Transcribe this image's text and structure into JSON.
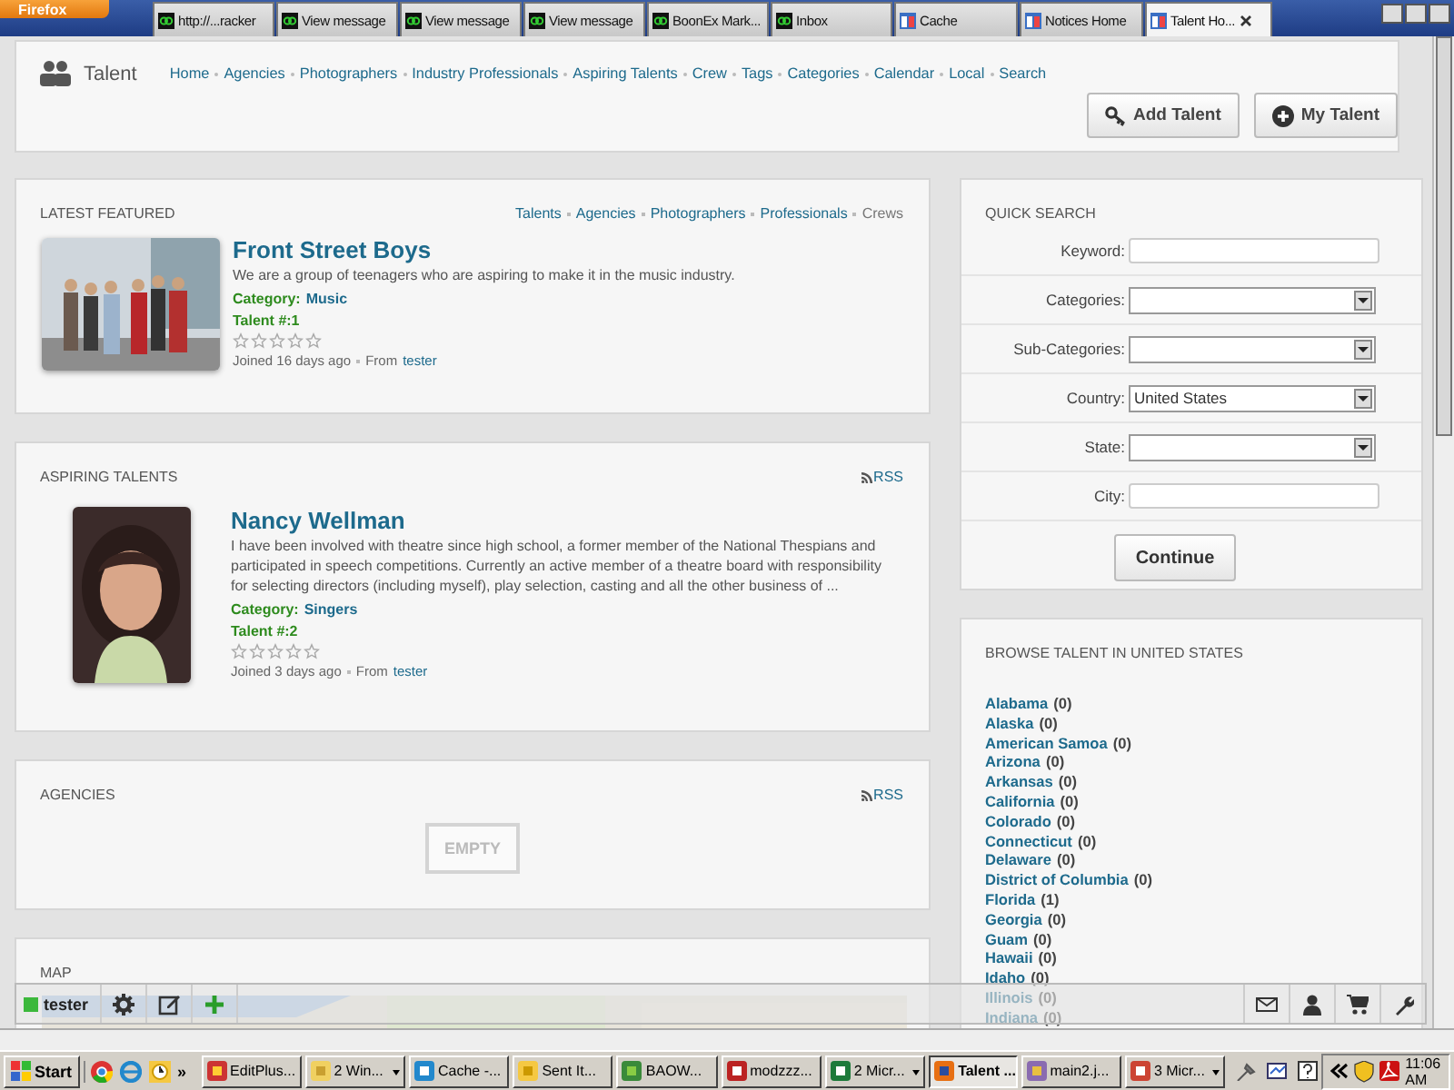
{
  "browser": {
    "menu_button": "Firefox",
    "tabs": [
      {
        "label": "http://...racker",
        "kind": "site",
        "selected": false
      },
      {
        "label": "View message",
        "kind": "site",
        "selected": false
      },
      {
        "label": "View message",
        "kind": "site",
        "selected": false
      },
      {
        "label": "View message",
        "kind": "site",
        "selected": false
      },
      {
        "label": "BoonEx Mark...",
        "kind": "site",
        "selected": false
      },
      {
        "label": "Inbox",
        "kind": "site",
        "selected": false
      },
      {
        "label": "Cache",
        "kind": "app",
        "selected": false
      },
      {
        "label": "Notices Home",
        "kind": "app",
        "selected": false
      },
      {
        "label": "Talent Ho...",
        "kind": "app",
        "selected": true
      }
    ]
  },
  "header": {
    "title": "Talent",
    "nav": [
      "Home",
      "Agencies",
      "Photographers",
      "Industry Professionals",
      "Aspiring Talents",
      "Crew",
      "Tags",
      "Categories",
      "Calendar",
      "Local",
      "Search"
    ],
    "buttons": [
      {
        "label": "Add Talent",
        "kind": "key"
      },
      {
        "label": "My Talent",
        "kind": "plus"
      }
    ]
  },
  "latest_featured": {
    "title": "LATEST FEATURED",
    "filters": [
      {
        "label": "Talents",
        "selected": false
      },
      {
        "label": "Agencies",
        "selected": false
      },
      {
        "label": "Photographers",
        "selected": false
      },
      {
        "label": "Professionals",
        "selected": false
      },
      {
        "label": "Crews",
        "selected": true
      }
    ],
    "item": {
      "kind": "group",
      "name": "Front Street Boys",
      "description": "We are a group of teenagers who are aspiring to make it in the music industry.",
      "category_label": "Category:",
      "category": "Music",
      "talent_no": "Talent #:1",
      "stars": 0,
      "joined": "Joined 16 days ago",
      "from_label": "From",
      "from_user": "tester"
    }
  },
  "aspiring_talents": {
    "title": "ASPIRING TALENTS",
    "rss": "RSS",
    "items": [
      {
        "kind": "portrait",
        "name": "Nancy Wellman",
        "description": "I have been involved with theatre since high school, a former member of the National Thespians and participated in speech competitions. Currently an active member of a theatre board with responsibility for selecting directors (including myself), play selection, casting and all the other business of ...",
        "category_label": "Category:",
        "category": "Singers",
        "talent_no": "Talent #:2",
        "stars": 0,
        "joined": "Joined 3 days ago",
        "from_label": "From",
        "from_user": "tester"
      }
    ]
  },
  "agencies": {
    "title": "AGENCIES",
    "rss": "RSS",
    "empty": "EMPTY"
  },
  "map": {
    "title": "MAP"
  },
  "quick_search": {
    "title": "QUICK SEARCH",
    "fields": [
      {
        "kind": "text",
        "label": "Keyword:"
      },
      {
        "kind": "select",
        "label": "Categories:"
      },
      {
        "kind": "select",
        "label": "Sub-Categories:"
      },
      {
        "kind": "select",
        "label": "Country:",
        "value": "United States"
      },
      {
        "kind": "select",
        "label": "State:"
      },
      {
        "kind": "text",
        "label": "City:"
      }
    ],
    "button": "Continue"
  },
  "browse": {
    "title": "BROWSE TALENT IN UNITED STATES",
    "states": [
      {
        "name": "Alabama",
        "count": "(0)"
      },
      {
        "name": "Alaska",
        "count": "(0)"
      },
      {
        "name": "American Samoa",
        "count": "(0)"
      },
      {
        "name": "Arizona",
        "count": "(0)"
      },
      {
        "name": "Arkansas",
        "count": "(0)"
      },
      {
        "name": "California",
        "count": "(0)"
      },
      {
        "name": "Colorado",
        "count": "(0)"
      },
      {
        "name": "Connecticut",
        "count": "(0)"
      },
      {
        "name": "Delaware",
        "count": "(0)"
      },
      {
        "name": "District of Columbia",
        "count": "(0)"
      },
      {
        "name": "Florida",
        "count": "(1)"
      },
      {
        "name": "Georgia",
        "count": "(0)"
      },
      {
        "name": "Guam",
        "count": "(0)"
      },
      {
        "name": "Hawaii",
        "count": "(0)"
      },
      {
        "name": "Idaho",
        "count": "(0)"
      },
      {
        "name": "Illinois",
        "count": "(0)"
      },
      {
        "name": "Indiana",
        "count": "(0)"
      }
    ]
  },
  "toolbar": {
    "user": "tester"
  },
  "taskbar": {
    "start": "Start",
    "overflow": "»",
    "items": [
      {
        "label": "EditPlus...",
        "kind": "editor",
        "grouped": false,
        "selected": false
      },
      {
        "label": "2 Win...",
        "kind": "folder",
        "grouped": true,
        "selected": false
      },
      {
        "label": "Cache -...",
        "kind": "ie",
        "grouped": false,
        "selected": false
      },
      {
        "label": "Sent It...",
        "kind": "mail",
        "grouped": false,
        "selected": false
      },
      {
        "label": "BAOW...",
        "kind": "game",
        "grouped": false,
        "selected": false
      },
      {
        "label": "modzzz...",
        "kind": "ftp",
        "grouped": false,
        "selected": false
      },
      {
        "label": "2 Micr...",
        "kind": "excel",
        "grouped": true,
        "selected": false
      },
      {
        "label": "Talent ...",
        "kind": "firefox",
        "grouped": false,
        "selected": true
      },
      {
        "label": "main2.j...",
        "kind": "archive",
        "grouped": false,
        "selected": false
      },
      {
        "label": "3 Micr...",
        "kind": "ppt",
        "grouped": true,
        "selected": false
      }
    ],
    "clock": "11:06 AM"
  }
}
